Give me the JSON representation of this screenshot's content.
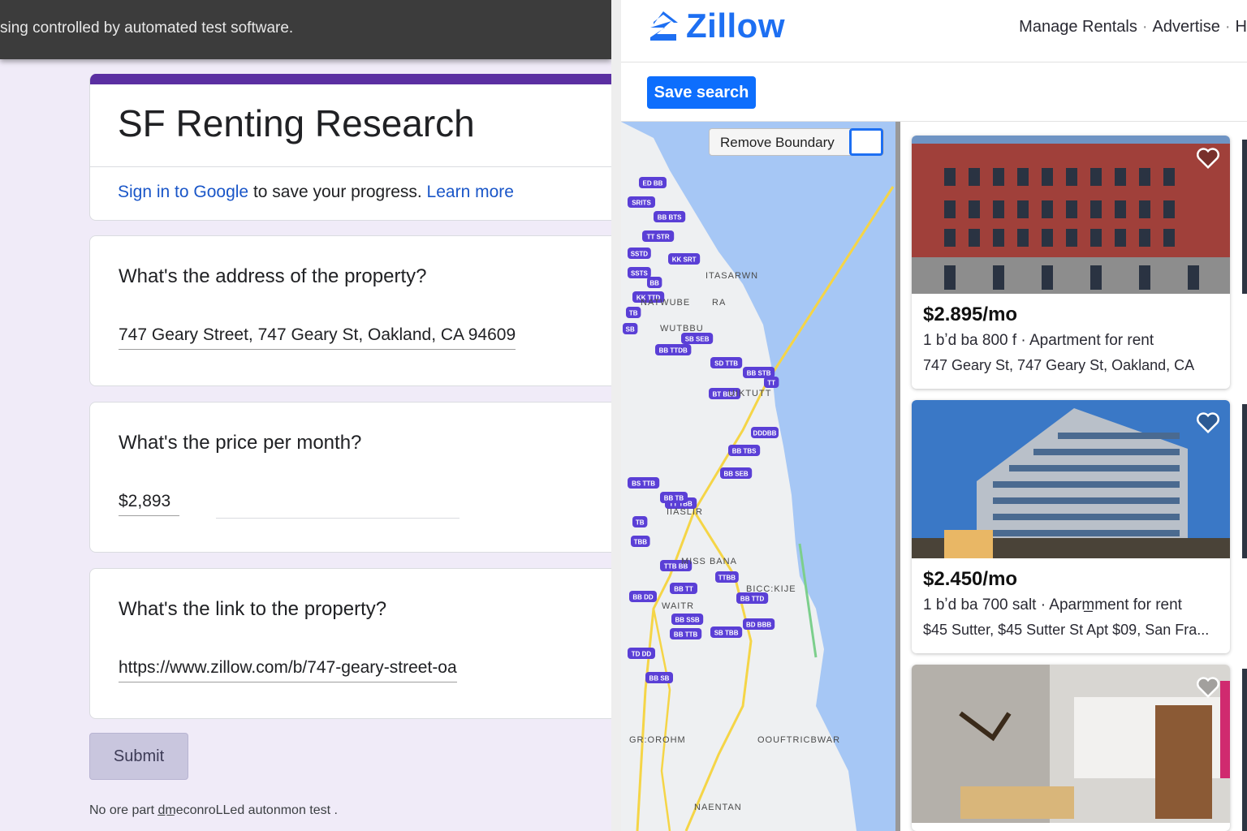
{
  "browser_infobar": {
    "text": "sing controlled by automated test software."
  },
  "form": {
    "title": "SF Renting Research",
    "signin_link": "Sign in to Google",
    "signin_text": " to save your progress. ",
    "learn_more": "Learn more",
    "questions": [
      {
        "label": "What's the address of the property?",
        "answer": "747 Geary Street, 747 Geary St, Oakland, CA 94609"
      },
      {
        "label": "What's the price per month?",
        "answer": "$2,893"
      },
      {
        "label": "What's the link to the property?",
        "answer": "https://www.zillow.com/b/747-geary-street-oa"
      }
    ],
    "submit_label": "Submit",
    "footer_note": "No ore part d̲m̲ecоnroLLed autonmon test ."
  },
  "zillow": {
    "logo_text": "Zillow",
    "nav": [
      "Manage Rentals",
      "Advertise",
      "H"
    ],
    "save_search_label": "Save search",
    "remove_boundary_label": "Remove Boundary",
    "map": {
      "colors": {
        "water": "#a6c7f5",
        "land": "#eef0f2",
        "highway": "#f5d547",
        "pin": "#5a3fd6"
      },
      "place_labels": [
        "MISS BANA",
        "BICC:KIJE",
        "WAITR",
        "GR:OROHM",
        "OOUFTRICBWAR",
        "NAENTAN",
        "ITASARWN",
        "WUTBBU",
        "NATWUBE",
        "UIKTUTT",
        "IIASLIR",
        "RA"
      ],
      "price_pins": [
        "ED BB",
        "SRITS",
        "BB BTS",
        "TT STR",
        "SSTD",
        "KK SRT",
        "SSTS",
        "BB",
        "KK TTD",
        "TB",
        "SB",
        "BB TTDB",
        "SB SEB",
        "SD TTB",
        "BB STB",
        "BT BBB",
        "TT",
        "DDDBB",
        "BB TBS",
        "BB SEB",
        "TT TBB",
        "TB",
        "BB TB",
        "BS TTB",
        "TBB",
        "TTB BB",
        "BB TT",
        "TTBB",
        "BB TTD",
        "BB DD",
        "BB SSB",
        "SB TBB",
        "TD DD",
        "BB SB",
        "BB TTB",
        "BD BBB"
      ]
    },
    "listings": [
      {
        "price": "$2.895/mo",
        "specs": "1 bʼd ba 800 f · Apartment for rent",
        "address": "747 Geary St, 747 Geary St, Oakland,  CA"
      },
      {
        "price": "$2.450/mo",
        "specs": "1 bʼd ba 700 salt · Aparm̲ment for rent",
        "address": "$45 Sutter, $45 Sutter St Apt $09, San Fra..."
      },
      {
        "price": "",
        "specs": "",
        "address": ""
      }
    ]
  }
}
